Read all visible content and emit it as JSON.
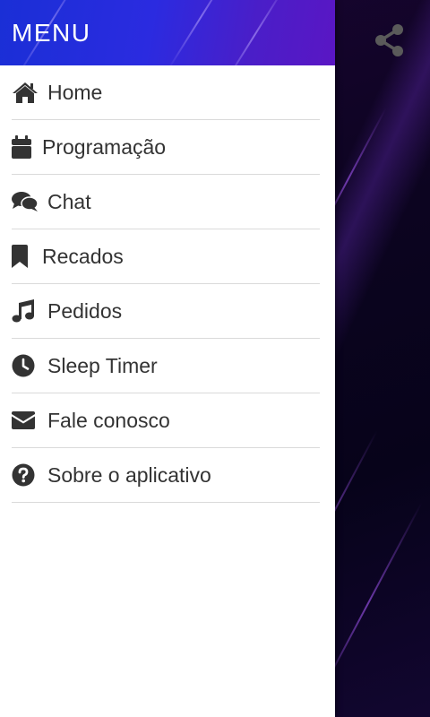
{
  "drawer": {
    "title": "MENU",
    "items": [
      {
        "label": "Home",
        "icon": "home-icon"
      },
      {
        "label": "Programação",
        "icon": "calendar-icon"
      },
      {
        "label": "Chat",
        "icon": "chat-icon"
      },
      {
        "label": "Recados",
        "icon": "bookmark-icon"
      },
      {
        "label": "Pedidos",
        "icon": "music-note-icon"
      },
      {
        "label": "Sleep Timer",
        "icon": "clock-icon"
      },
      {
        "label": "Fale conosco",
        "icon": "envelope-icon"
      },
      {
        "label": "Sobre o aplicativo",
        "icon": "question-circle-icon"
      }
    ]
  },
  "toolbar": {
    "share_icon": "share-icon"
  },
  "colors": {
    "header_gradient_start": "#1a2fd6",
    "header_gradient_end": "#5a16c4",
    "menu_text": "#333333",
    "divider": "#dadada",
    "background_dark": "#0b0418",
    "share_icon": "#555555"
  }
}
